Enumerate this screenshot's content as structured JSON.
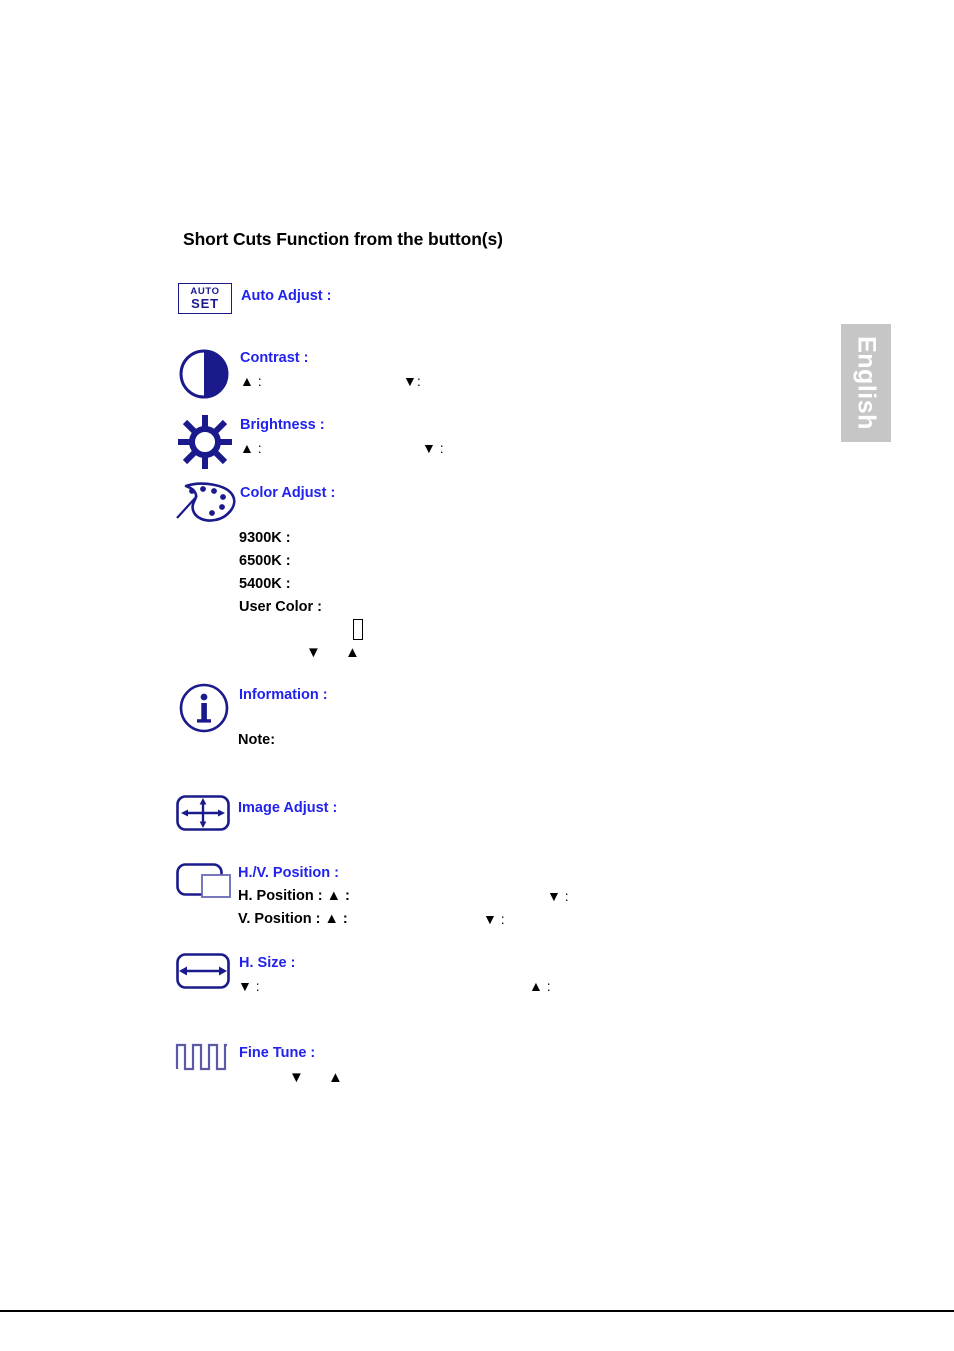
{
  "document": {
    "title": "Short Cuts Function from the button(s)"
  },
  "language_tab": {
    "label": "English"
  },
  "auto_set_button": {
    "line1": "AUTO",
    "line2": "SET"
  },
  "colors": {
    "heading_text": "#000000",
    "item_label_blue": "#2222ee",
    "icon_navy": "#1a1a8c",
    "body_text": "#000000",
    "lang_tab_background": "#c6c6c6",
    "lang_tab_text": "#ffffff",
    "page_background": "#ffffff",
    "footer_rule": "#000000"
  },
  "items": [
    {
      "icon": "auto-set-button-icon",
      "label": "Auto Adjust :",
      "sub_lines": []
    },
    {
      "icon": "contrast-half-circle-icon",
      "label": "Contrast :",
      "sub_lines": [
        {
          "up_marker": "▲ :",
          "down_marker": "▼:"
        }
      ]
    },
    {
      "icon": "brightness-sun-icon",
      "label": "Brightness :",
      "sub_lines": [
        {
          "up_marker": "▲ :",
          "down_marker": "▼ :"
        }
      ]
    },
    {
      "icon": "color-adjust-palette-icon",
      "label": "Color Adjust :",
      "options": [
        "9300K :",
        "6500K :",
        "5400K :",
        "User Color :"
      ],
      "markers": {
        "down": "▼",
        "up": "▲"
      }
    },
    {
      "icon": "information-circle-i-icon",
      "label": "Information :",
      "note_label": "Note:"
    },
    {
      "icon": "image-adjust-cross-arrows-icon",
      "label": "Image Adjust :",
      "sub_lines": []
    },
    {
      "icon": "hv-position-overlap-rect-icon",
      "label": "H./V. Position :",
      "sub_lines": [
        {
          "text": "H. Position : ▲ :",
          "down_marker": "▼ :"
        },
        {
          "text": "V. Position : ▲ :",
          "down_marker": "▼ :"
        }
      ]
    },
    {
      "icon": "h-size-horizontal-arrow-icon",
      "label": "H. Size :",
      "sub_lines": [
        {
          "down_marker": "▼ :",
          "up_marker": "▲ :"
        }
      ]
    },
    {
      "icon": "fine-tune-square-wave-icon",
      "label": "Fine Tune :",
      "markers": {
        "down": "▼",
        "up": "▲"
      }
    }
  ]
}
